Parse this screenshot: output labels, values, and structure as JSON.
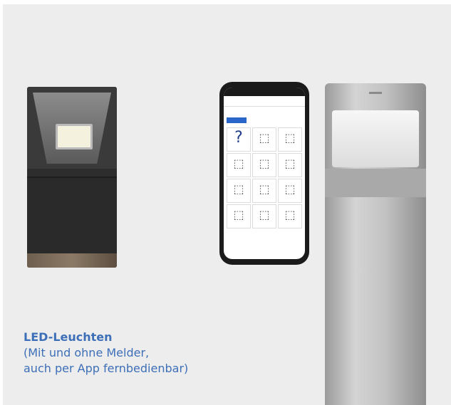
{
  "caption": {
    "title": "LED-Leuchten",
    "line1": "(Mit und ohne Melder,",
    "line2": "auch per App fernbedienbar)"
  },
  "colors": {
    "accent": "#3d6fb8",
    "background": "#ededed"
  },
  "phone_app": {
    "tiles": [
      "?",
      "⬚",
      "⬚",
      "⬚",
      "⬚",
      "⬚",
      "⬚",
      "⬚",
      "⬚",
      "⬚",
      "⬚",
      "⬚"
    ]
  }
}
